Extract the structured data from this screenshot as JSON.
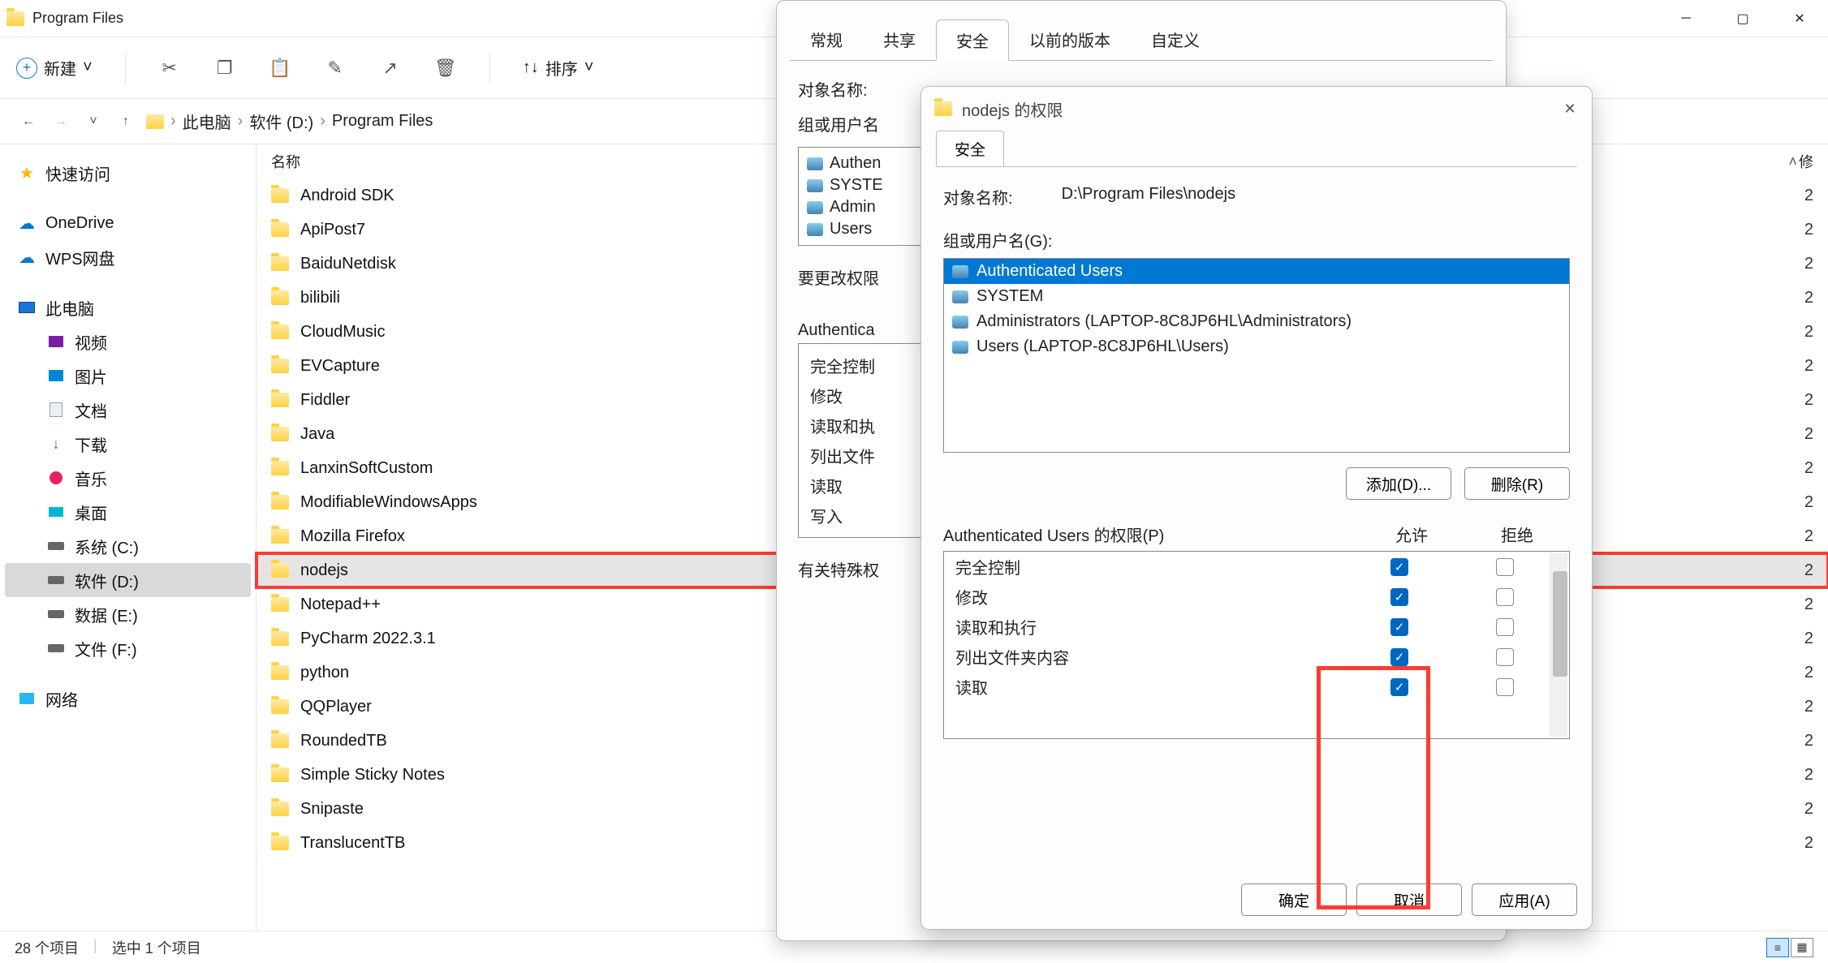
{
  "window": {
    "title": "Program Files"
  },
  "toolbar": {
    "new_label": "新建",
    "sort_label": "排序"
  },
  "breadcrumb": {
    "root": "此电脑",
    "drive": "软件 (D:)",
    "folder": "Program Files"
  },
  "sidebar": {
    "quick": "快速访问",
    "onedrive": "OneDrive",
    "wps": "WPS网盘",
    "thispc": "此电脑",
    "video": "视频",
    "pictures": "图片",
    "documents": "文档",
    "downloads": "下载",
    "music": "音乐",
    "desktop": "桌面",
    "sysc": "系统 (C:)",
    "softd": "软件 (D:)",
    "datae": "数据 (E:)",
    "filef": "文件 (F:)",
    "network": "网络"
  },
  "list_header": {
    "name": "名称",
    "datecol": "修"
  },
  "files": [
    {
      "name": "Android SDK",
      "d": "2"
    },
    {
      "name": "ApiPost7",
      "d": "2"
    },
    {
      "name": "BaiduNetdisk",
      "d": "2"
    },
    {
      "name": "bilibili",
      "d": "2"
    },
    {
      "name": "CloudMusic",
      "d": "2"
    },
    {
      "name": "EVCapture",
      "d": "2"
    },
    {
      "name": "Fiddler",
      "d": "2"
    },
    {
      "name": "Java",
      "d": "2"
    },
    {
      "name": "LanxinSoftCustom",
      "d": "2"
    },
    {
      "name": "ModifiableWindowsApps",
      "d": "2"
    },
    {
      "name": "Mozilla Firefox",
      "d": "2"
    },
    {
      "name": "nodejs",
      "d": "2",
      "selected": true,
      "highlighted": true
    },
    {
      "name": "Notepad++",
      "d": "2"
    },
    {
      "name": "PyCharm 2022.3.1",
      "d": "2"
    },
    {
      "name": "python",
      "d": "2"
    },
    {
      "name": "QQPlayer",
      "d": "2"
    },
    {
      "name": "RoundedTB",
      "d": "2"
    },
    {
      "name": "Simple Sticky Notes",
      "d": "2"
    },
    {
      "name": "Snipaste",
      "d": "2"
    },
    {
      "name": "TranslucentTB",
      "d": "2"
    }
  ],
  "status": {
    "count": "28 个项目",
    "selected": "选中 1 个项目"
  },
  "props": {
    "tabs": [
      "常规",
      "共享",
      "安全",
      "以前的版本",
      "自定义"
    ],
    "active_tab": 2,
    "object_label": "对象名称:",
    "group_label": "组或用户名",
    "users": [
      "Authen",
      "SYSTE",
      "Admin",
      "Users"
    ],
    "change_label": "要更改权限",
    "perm_for": "Authentica",
    "perm_rows": [
      "完全控制",
      "修改",
      "读取和执",
      "列出文件",
      "读取",
      "写入"
    ],
    "special_label": "有关特殊权"
  },
  "perms": {
    "title": "nodejs 的权限",
    "tab": "安全",
    "object_label": "对象名称:",
    "object_path": "D:\\Program Files\\nodejs",
    "group_label": "组或用户名(G):",
    "users": [
      "Authenticated Users",
      "SYSTEM",
      "Administrators (LAPTOP-8C8JP6HL\\Administrators)",
      "Users (LAPTOP-8C8JP6HL\\Users)"
    ],
    "selected_user": 0,
    "add_btn": "添加(D)...",
    "remove_btn": "删除(R)",
    "perm_for_label": "Authenticated Users 的权限(P)",
    "col_allow": "允许",
    "col_deny": "拒绝",
    "rows": [
      {
        "name": "完全控制",
        "allow": true,
        "deny": false
      },
      {
        "name": "修改",
        "allow": true,
        "deny": false
      },
      {
        "name": "读取和执行",
        "allow": true,
        "deny": false
      },
      {
        "name": "列出文件夹内容",
        "allow": true,
        "deny": false
      },
      {
        "name": "读取",
        "allow": true,
        "deny": false
      }
    ],
    "ok": "确定",
    "cancel": "取消",
    "apply": "应用(A)"
  }
}
